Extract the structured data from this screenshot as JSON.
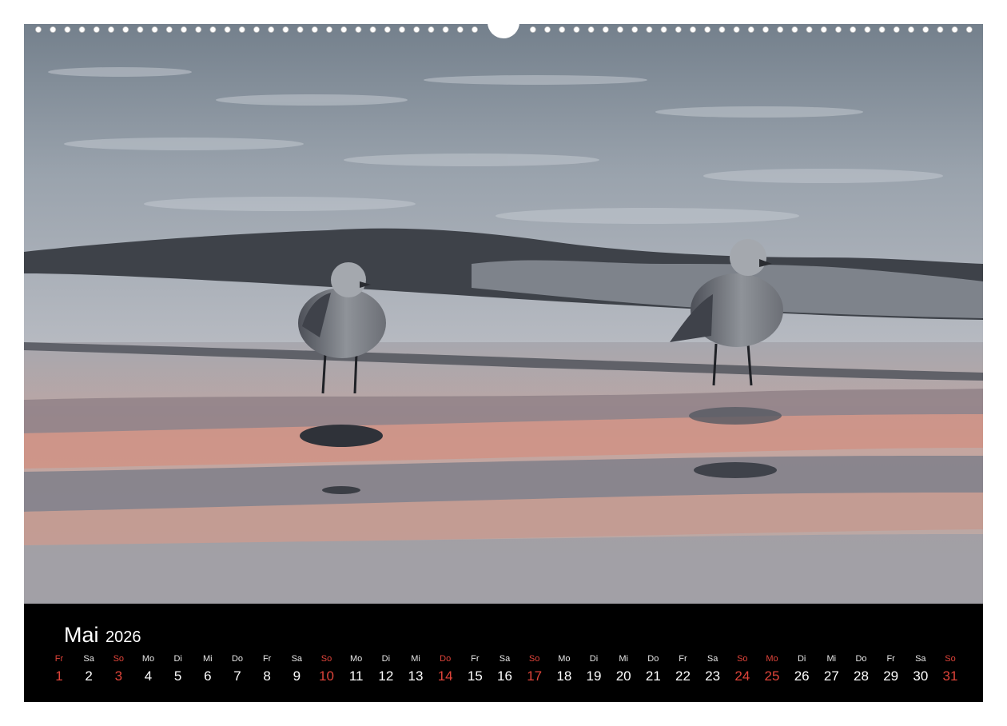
{
  "calendar": {
    "month": "Mai",
    "year": "2026",
    "sunday_color": "#e0443a",
    "days": [
      {
        "wd": "Fr",
        "d": "1",
        "red": true
      },
      {
        "wd": "Sa",
        "d": "2",
        "red": false
      },
      {
        "wd": "So",
        "d": "3",
        "red": true
      },
      {
        "wd": "Mo",
        "d": "4",
        "red": false
      },
      {
        "wd": "Di",
        "d": "5",
        "red": false
      },
      {
        "wd": "Mi",
        "d": "6",
        "red": false
      },
      {
        "wd": "Do",
        "d": "7",
        "red": false
      },
      {
        "wd": "Fr",
        "d": "8",
        "red": false
      },
      {
        "wd": "Sa",
        "d": "9",
        "red": false
      },
      {
        "wd": "So",
        "d": "10",
        "red": true
      },
      {
        "wd": "Mo",
        "d": "11",
        "red": false
      },
      {
        "wd": "Di",
        "d": "12",
        "red": false
      },
      {
        "wd": "Mi",
        "d": "13",
        "red": false
      },
      {
        "wd": "Do",
        "d": "14",
        "red": true
      },
      {
        "wd": "Fr",
        "d": "15",
        "red": false
      },
      {
        "wd": "Sa",
        "d": "16",
        "red": false
      },
      {
        "wd": "So",
        "d": "17",
        "red": true
      },
      {
        "wd": "Mo",
        "d": "18",
        "red": false
      },
      {
        "wd": "Di",
        "d": "19",
        "red": false
      },
      {
        "wd": "Mi",
        "d": "20",
        "red": false
      },
      {
        "wd": "Do",
        "d": "21",
        "red": false
      },
      {
        "wd": "Fr",
        "d": "22",
        "red": false
      },
      {
        "wd": "Sa",
        "d": "23",
        "red": false
      },
      {
        "wd": "So",
        "d": "24",
        "red": true
      },
      {
        "wd": "Mo",
        "d": "25",
        "red": true
      },
      {
        "wd": "Di",
        "d": "26",
        "red": false
      },
      {
        "wd": "Mi",
        "d": "27",
        "red": false
      },
      {
        "wd": "Do",
        "d": "28",
        "red": false
      },
      {
        "wd": "Fr",
        "d": "29",
        "red": false
      },
      {
        "wd": "Sa",
        "d": "30",
        "red": false
      },
      {
        "wd": "So",
        "d": "31",
        "red": true
      }
    ]
  }
}
